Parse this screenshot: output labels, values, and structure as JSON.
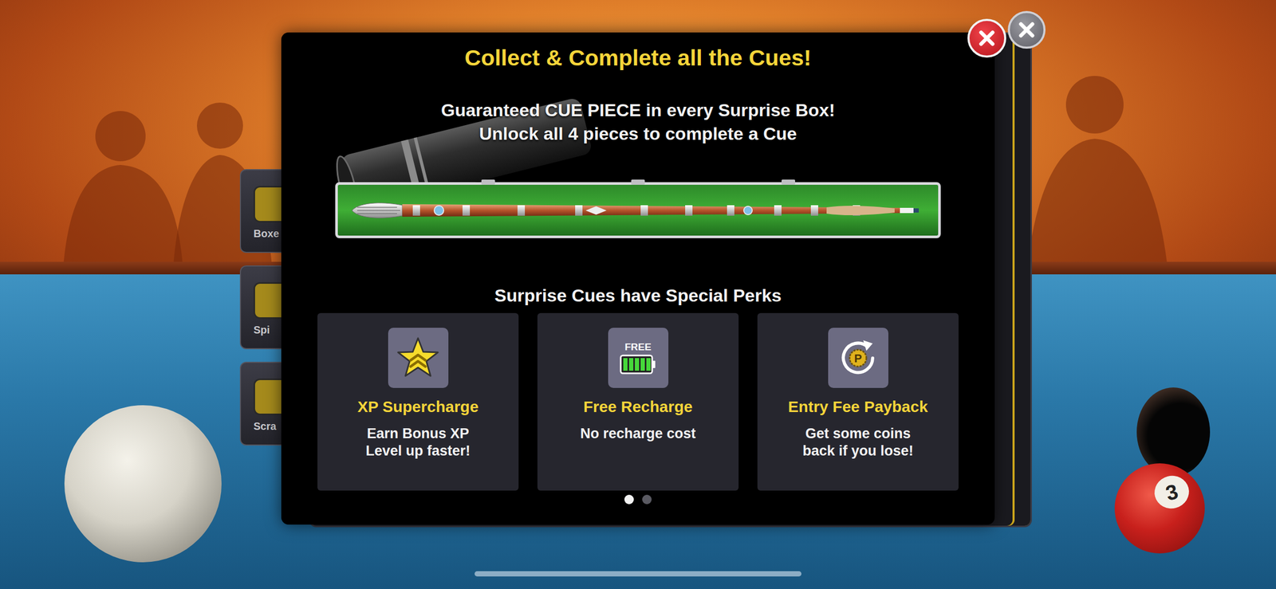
{
  "side_menu": [
    {
      "label": "Boxe"
    },
    {
      "label": "Spi"
    },
    {
      "label": "Scra"
    }
  ],
  "dialog": {
    "title": "Collect & Complete all the Cues!",
    "subtitle": [
      "Guaranteed CUE PIECE in every Surprise Box!",
      "Unlock all 4 pieces to complete a Cue"
    ],
    "perks_heading": "Surprise Cues have Special Perks",
    "perks": [
      {
        "kind": "xp",
        "icon_text": "",
        "title": "XP Supercharge",
        "description": [
          "Earn Bonus XP",
          "Level up faster!"
        ]
      },
      {
        "kind": "recharge",
        "icon_text": "FREE",
        "title": "Free Recharge",
        "description": [
          "No recharge cost"
        ]
      },
      {
        "kind": "payback",
        "icon_text": "P",
        "title": "Entry Fee Payback",
        "description": [
          "Get some coins",
          "back if you lose!"
        ]
      }
    ],
    "pages": [
      {
        "selected": true
      },
      {
        "selected": false
      }
    ]
  },
  "balls": [
    {
      "number": "3"
    }
  ]
}
